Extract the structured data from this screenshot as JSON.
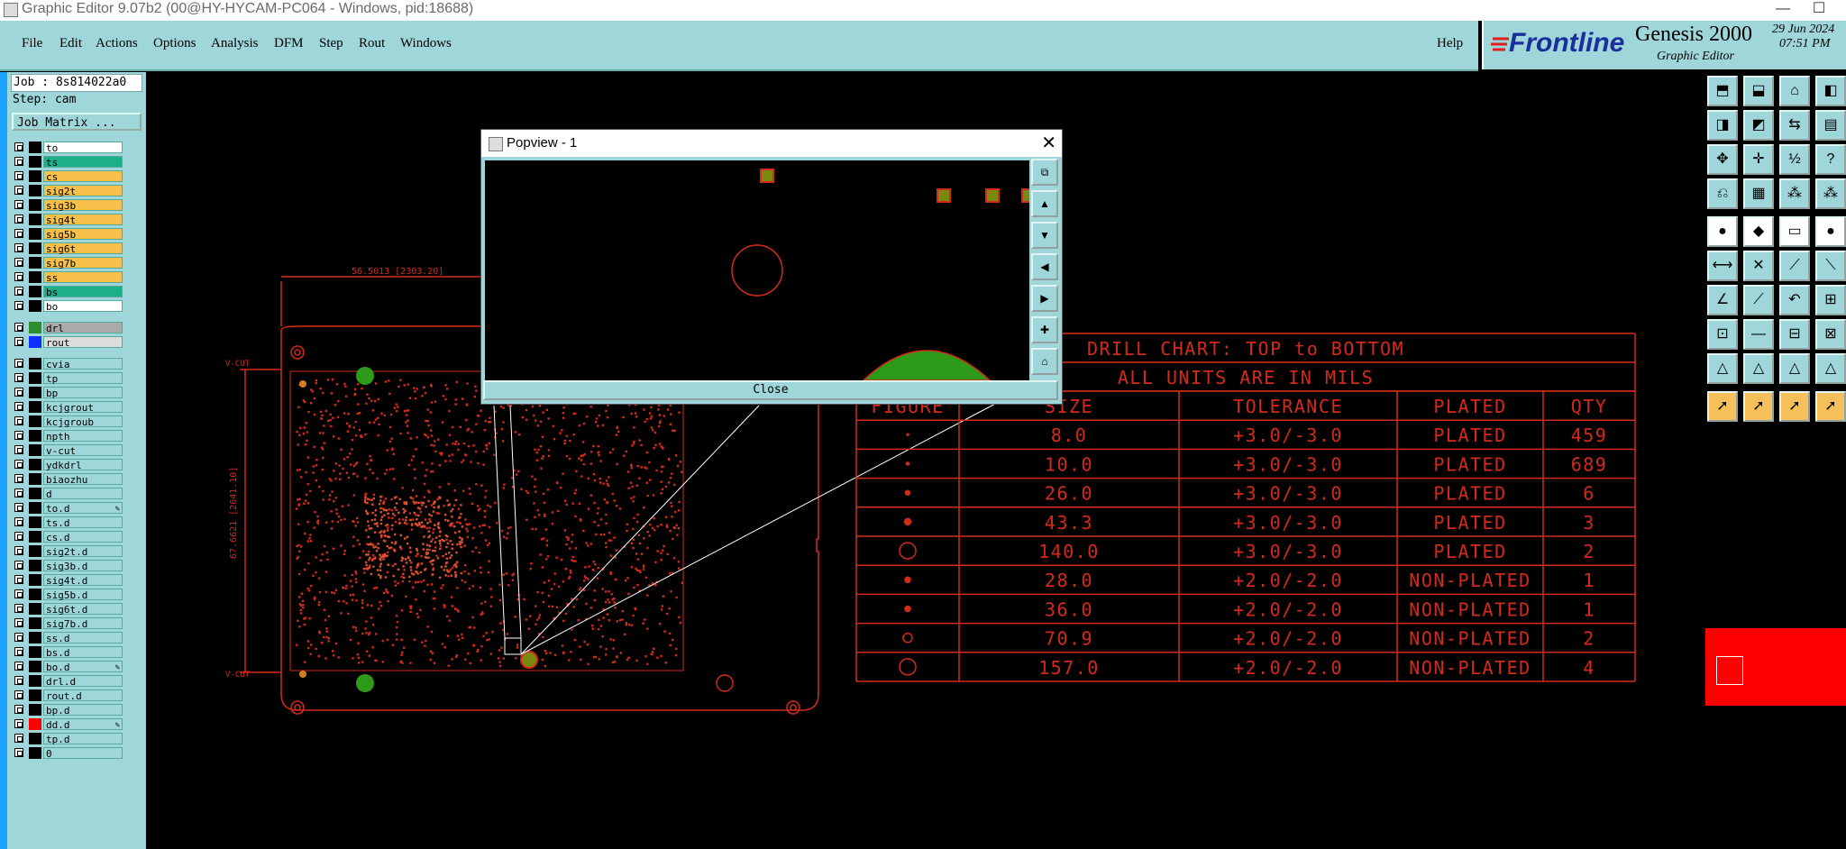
{
  "window": {
    "title": "Graphic Editor 9.07b2 (00@HY-HYCAM-PC064 - Windows, pid:18688)",
    "controls": [
      "—",
      "☐"
    ]
  },
  "menu": {
    "items": [
      "File",
      "Edit",
      "Actions",
      "Options",
      "Analysis",
      "DFM",
      "Step",
      "Rout",
      "Windows"
    ],
    "help": "Help"
  },
  "brand": {
    "logo": "Frontline",
    "product": "Genesis 2000",
    "subtitle": "Graphic Editor",
    "date": "29 Jun 2024",
    "time": "07:51 PM"
  },
  "job": {
    "job_line": "Job : 8s814022a0",
    "step_line": "Step: cam",
    "matrix_button": "Job Matrix ..."
  },
  "layers": [
    {
      "name": "to",
      "color": "#ffffff"
    },
    {
      "name": "ts",
      "color": "#1bb08a"
    },
    {
      "name": "cs",
      "color": "#f7c04a"
    },
    {
      "name": "sig2t",
      "color": "#f7c04a"
    },
    {
      "name": "sig3b",
      "color": "#f7c04a"
    },
    {
      "name": "sig4t",
      "color": "#f7c04a"
    },
    {
      "name": "sig5b",
      "color": "#f7c04a"
    },
    {
      "name": "sig6t",
      "color": "#f7c04a"
    },
    {
      "name": "sig7b",
      "color": "#f7c04a"
    },
    {
      "name": "ss",
      "color": "#f7c04a"
    },
    {
      "name": "bs",
      "color": "#1bb08a"
    },
    {
      "name": "bo",
      "color": "#ffffff"
    }
  ],
  "drill_layers": [
    {
      "name": "drl",
      "swatch": "#2e8b2e"
    },
    {
      "name": "rout",
      "swatch": "#1030ff"
    }
  ],
  "other_layers": [
    {
      "name": "cvia",
      "pen": ""
    },
    {
      "name": "tp",
      "pen": ""
    },
    {
      "name": "bp",
      "pen": ""
    },
    {
      "name": "kcjgrout",
      "pen": ""
    },
    {
      "name": "kcjgroub",
      "pen": ""
    },
    {
      "name": "npth",
      "pen": ""
    },
    {
      "name": "v-cut",
      "pen": ""
    },
    {
      "name": "ydkdrl",
      "pen": ""
    },
    {
      "name": "biaozhu",
      "pen": ""
    },
    {
      "name": "d",
      "pen": ""
    },
    {
      "name": "to.d",
      "pen": "✎"
    },
    {
      "name": "ts.d",
      "pen": ""
    },
    {
      "name": "cs.d",
      "pen": ""
    },
    {
      "name": "sig2t.d",
      "pen": ""
    },
    {
      "name": "sig3b.d",
      "pen": ""
    },
    {
      "name": "sig4t.d",
      "pen": ""
    },
    {
      "name": "sig5b.d",
      "pen": ""
    },
    {
      "name": "sig6t.d",
      "pen": ""
    },
    {
      "name": "sig7b.d",
      "pen": ""
    },
    {
      "name": "ss.d",
      "pen": ""
    },
    {
      "name": "bs.d",
      "pen": ""
    },
    {
      "name": "bo.d",
      "pen": "✎"
    },
    {
      "name": "drl.d",
      "pen": ""
    },
    {
      "name": "rout.d",
      "pen": ""
    },
    {
      "name": "bp.d",
      "pen": ""
    },
    {
      "name": "dd.d",
      "pen": "✎"
    },
    {
      "name": "tp.d",
      "pen": ""
    },
    {
      "name": "0",
      "pen": ""
    }
  ],
  "popview": {
    "title": "Popview - 1",
    "close_label": "Close"
  },
  "drill_chart": {
    "title": "DRILL CHART: TOP to BOTTOM",
    "subtitle": "ALL UNITS ARE IN MILS",
    "headers": [
      "FIGURE",
      "SIZE",
      "TOLERANCE",
      "PLATED",
      "QTY"
    ],
    "rows": [
      {
        "size": "8.0",
        "tol": "+3.0/-3.0",
        "plated": "PLATED",
        "qty": "459"
      },
      {
        "size": "10.0",
        "tol": "+3.0/-3.0",
        "plated": "PLATED",
        "qty": "689"
      },
      {
        "size": "26.0",
        "tol": "+3.0/-3.0",
        "plated": "PLATED",
        "qty": "6"
      },
      {
        "size": "43.3",
        "tol": "+3.0/-3.0",
        "plated": "PLATED",
        "qty": "3"
      },
      {
        "size": "140.0",
        "tol": "+3.0/-3.0",
        "plated": "PLATED",
        "qty": "2"
      },
      {
        "size": "28.0",
        "tol": "+2.0/-2.0",
        "plated": "NON-PLATED",
        "qty": "1"
      },
      {
        "size": "36.0",
        "tol": "+2.0/-2.0",
        "plated": "NON-PLATED",
        "qty": "1"
      },
      {
        "size": "70.9",
        "tol": "+2.0/-2.0",
        "plated": "NON-PLATED",
        "qty": "2"
      },
      {
        "size": "157.0",
        "tol": "+2.0/-2.0",
        "plated": "NON-PLATED",
        "qty": "4"
      }
    ]
  },
  "board": {
    "top_dim": "56.5013 [2303.20]",
    "side_dim": "67.6621 [2641.10]",
    "vcut_top": "V-CUT",
    "vcut_bottom": "V-CUT"
  },
  "colors": {
    "ui_cyan": "#9fd6d9",
    "drawing_red": "#d42a1a",
    "pad_green": "#2e9a1a"
  }
}
